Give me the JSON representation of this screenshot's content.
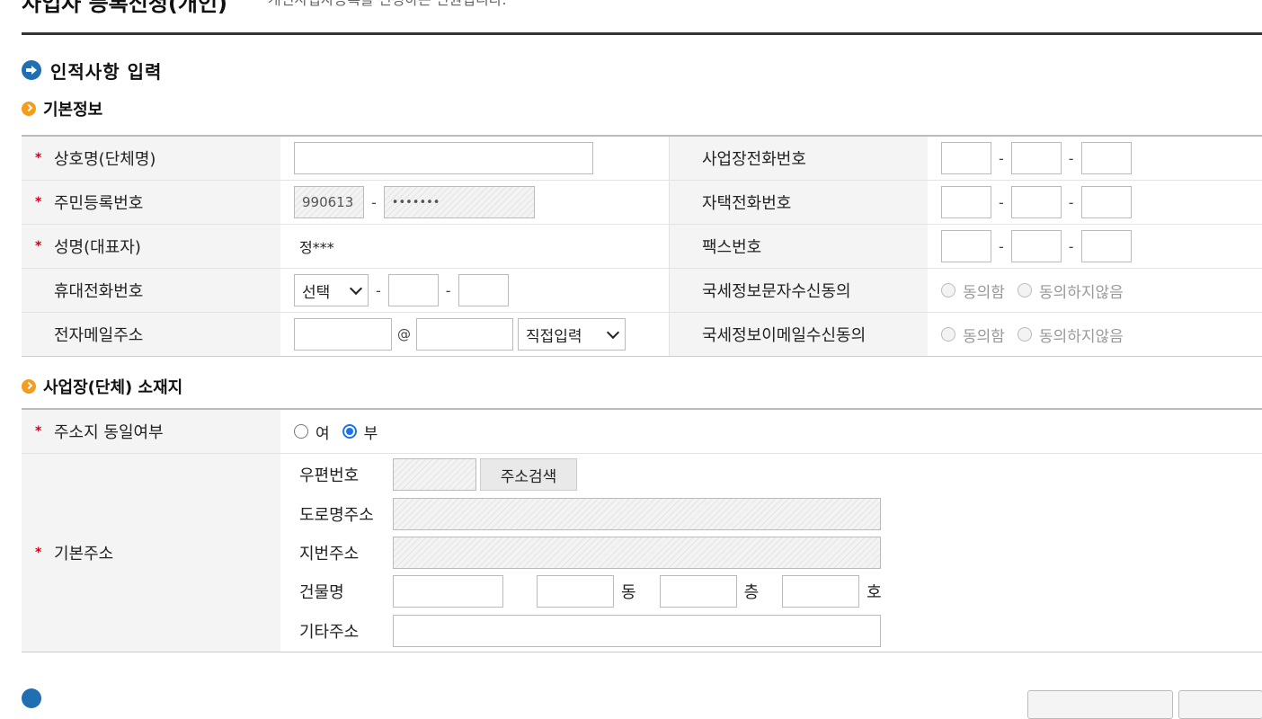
{
  "header": {
    "title": "사업자 등록신청(개인)",
    "description": "개인사업자등록을 신청하는 민원입니다."
  },
  "section1": {
    "title": "인적사항 입력"
  },
  "basic": {
    "title": "기본정보",
    "company_name_label": "상호명(단체명)",
    "rrn_label": "주민등록번호",
    "rrn_front": "990613",
    "rrn_back": "•••••••",
    "name_label": "성명(대표자)",
    "name_value": "정***",
    "mobile_label": "휴대전화번호",
    "mobile_select": "선택",
    "email_label": "전자메일주소",
    "email_at": "@",
    "email_domain_select": "직접입력",
    "biz_phone_label": "사업장전화번호",
    "home_phone_label": "자택전화번호",
    "fax_label": "팩스번호",
    "sms_consent_label": "국세정보문자수신동의",
    "email_consent_label": "국세정보이메일수신동의",
    "agree": "동의함",
    "disagree": "동의하지않음",
    "dash": "-"
  },
  "location": {
    "title": "사업장(단체) 소재지",
    "same_label": "주소지 동일여부",
    "yes": "여",
    "no": "부",
    "selected": "부",
    "address_label": "기본주소",
    "zip_label": "우편번호",
    "search_button": "주소검색",
    "road_label": "도로명주소",
    "lot_label": "지번주소",
    "building_label": "건물명",
    "dong": "동",
    "floor": "층",
    "ho": "호",
    "etc_label": "기타주소"
  },
  "colors": {
    "accent_blue": "#1f6fb2",
    "bullet_orange": "#f39c1e",
    "required_red": "#d0021b"
  }
}
